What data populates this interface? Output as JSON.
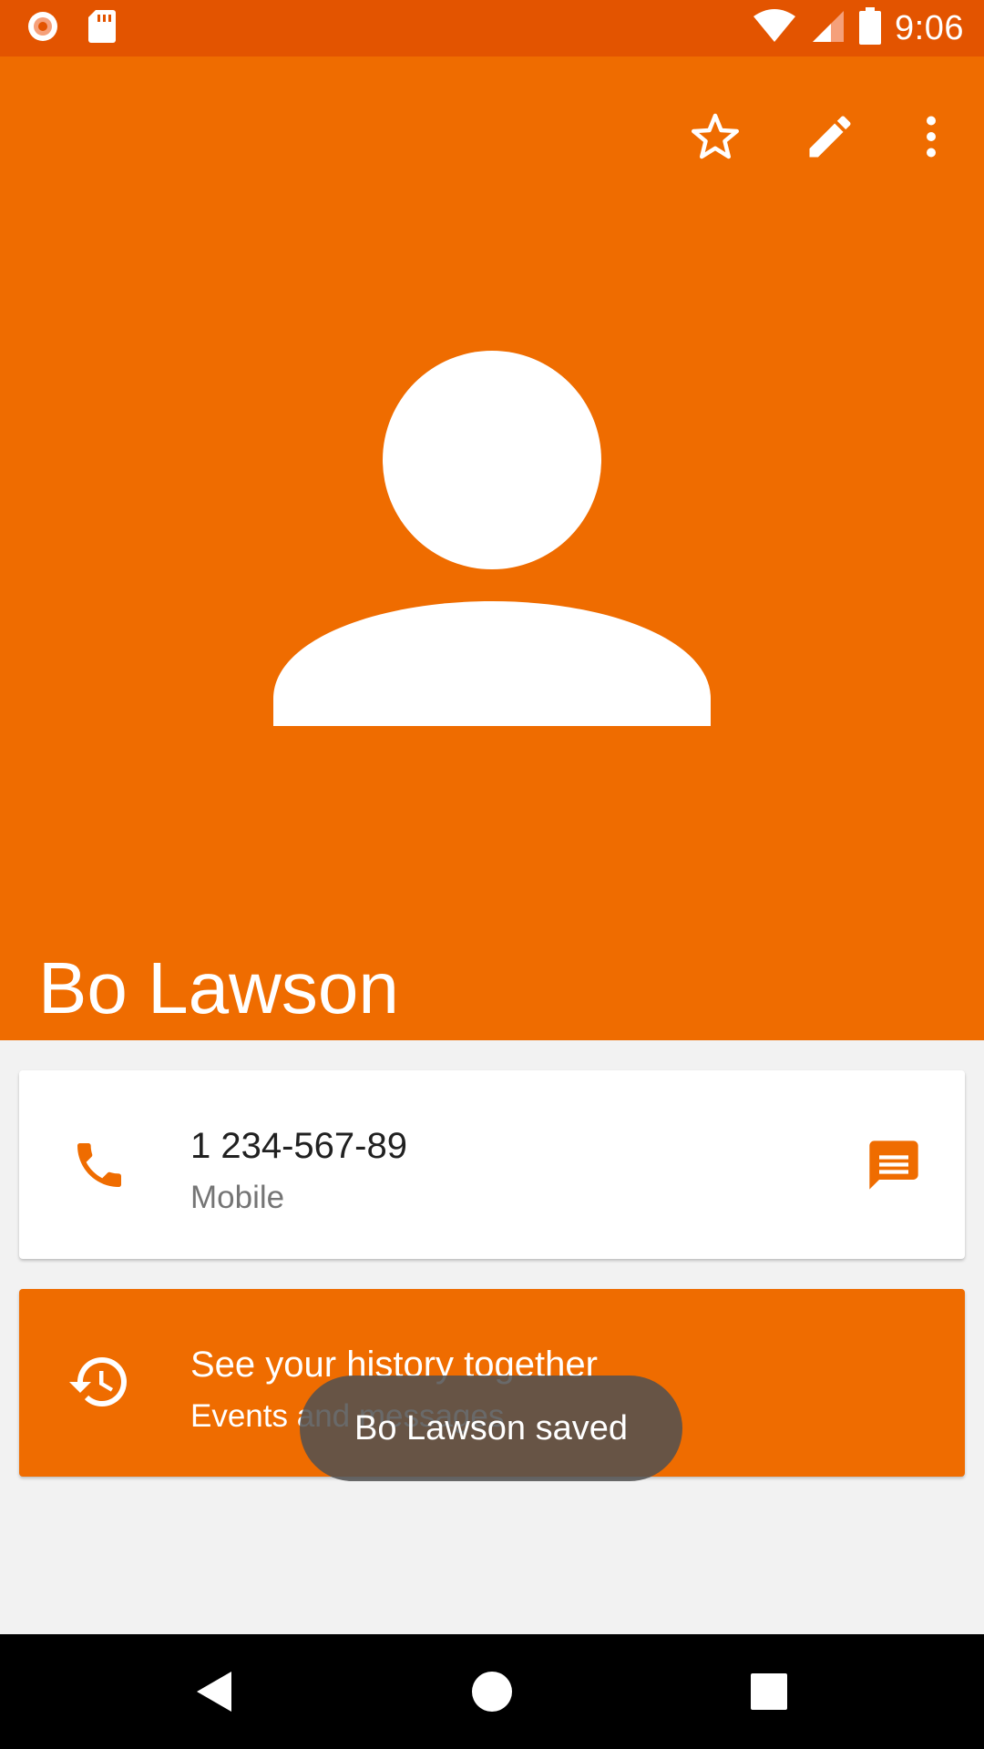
{
  "status_bar": {
    "time": "9:06",
    "icons": [
      "record-icon",
      "sd-card-icon",
      "wifi-icon",
      "signal-icon",
      "battery-icon"
    ]
  },
  "header": {
    "contact_name": "Bo Lawson",
    "actions": [
      "star-icon",
      "edit-icon",
      "more-vert-icon"
    ]
  },
  "phone_card": {
    "number": "1 234-567-89",
    "type": "Mobile"
  },
  "history_card": {
    "title": "See your history together",
    "subtitle": "Events and messages"
  },
  "toast": {
    "message": "Bo Lawson saved"
  },
  "nav_bar": {
    "buttons": [
      "back-icon",
      "home-icon",
      "recents-icon"
    ]
  },
  "colors": {
    "status_bar": "#e35400",
    "header": "#ef6c00",
    "accent": "#ef6c00",
    "background": "#f2f2f2"
  }
}
